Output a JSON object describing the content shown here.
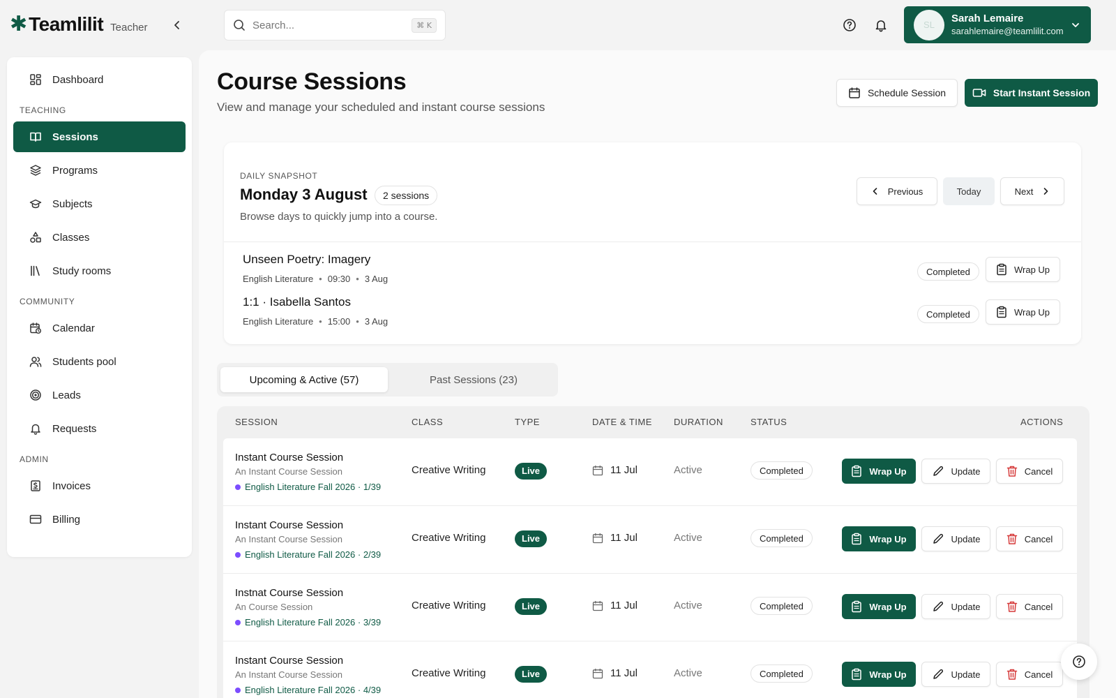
{
  "brand": {
    "name": "Teamlilit",
    "role": "Teacher",
    "accent": "#0f5a45"
  },
  "search": {
    "placeholder": "Search...",
    "shortcut": "⌘ K"
  },
  "user": {
    "initials": "SL",
    "name": "Sarah Lemaire",
    "email": "sarahlemaire@teamlilit.com"
  },
  "sidebar": {
    "dashboard": "Dashboard",
    "section_teaching": "TEACHING",
    "sessions": "Sessions",
    "programs": "Programs",
    "subjects": "Subjects",
    "classes": "Classes",
    "study_rooms": "Study rooms",
    "section_community": "COMMUNITY",
    "calendar": "Calendar",
    "students_pool": "Students pool",
    "leads": "Leads",
    "requests": "Requests",
    "section_admin": "ADMIN",
    "invoices": "Invoices",
    "billing": "Billing"
  },
  "page": {
    "title": "Course Sessions",
    "subtitle": "View and manage your scheduled and instant course sessions",
    "schedule_label": "Schedule Session",
    "instant_label": "Start Instant Session"
  },
  "snapshot": {
    "label": "DAILY SNAPSHOT",
    "date": "Monday 3 August",
    "count": "2 sessions",
    "description": "Browse days to quickly jump into a course.",
    "prev_label": "Previous",
    "today_label": "Today",
    "next_label": "Next",
    "sessions": [
      {
        "title": "Unseen Poetry: Imagery",
        "subject": "English Literature",
        "time": "09:30",
        "date": "3 Aug",
        "status": "Completed",
        "action": "Wrap Up"
      },
      {
        "title": "1:1 · Isabella Santos",
        "subject": "English Literature",
        "time": "15:00",
        "date": "3 Aug",
        "status": "Completed",
        "action": "Wrap Up"
      }
    ]
  },
  "tabs": {
    "upcoming": "Upcoming & Active (57)",
    "past": "Past Sessions (23)"
  },
  "table": {
    "headers": {
      "session": "SESSION",
      "class": "CLASS",
      "type": "TYPE",
      "datetime": "DATE & TIME",
      "duration": "DURATION",
      "status": "STATUS",
      "actions": "ACTIONS"
    },
    "rows": [
      {
        "title": "Instant Course Session",
        "subtitle": "An Instant Course Session",
        "program": "English Literature Fall 2026 · 1/39",
        "class": "Creative Writing",
        "type": "Live",
        "date": "11 Jul",
        "duration": "Active",
        "status": "Completed",
        "wrap": "Wrap Up",
        "update": "Update",
        "cancel": "Cancel"
      },
      {
        "title": "Instant Course Session",
        "subtitle": "An Instant Course Session",
        "program": "English Literature Fall 2026 · 2/39",
        "class": "Creative Writing",
        "type": "Live",
        "date": "11 Jul",
        "duration": "Active",
        "status": "Completed",
        "wrap": "Wrap Up",
        "update": "Update",
        "cancel": "Cancel"
      },
      {
        "title": "Instnat Course Session",
        "subtitle": "An Course Session",
        "program": "English Literature Fall 2026 · 3/39",
        "class": "Creative Writing",
        "type": "Live",
        "date": "11 Jul",
        "duration": "Active",
        "status": "Completed",
        "wrap": "Wrap Up",
        "update": "Update",
        "cancel": "Cancel"
      },
      {
        "title": "Instant Course Session",
        "subtitle": "An Instant Course Session",
        "program": "English Literature Fall 2026 · 4/39",
        "class": "Creative Writing",
        "type": "Live",
        "date": "11 Jul",
        "duration": "Active",
        "status": "Completed",
        "wrap": "Wrap Up",
        "update": "Update",
        "cancel": "Cancel"
      }
    ]
  }
}
